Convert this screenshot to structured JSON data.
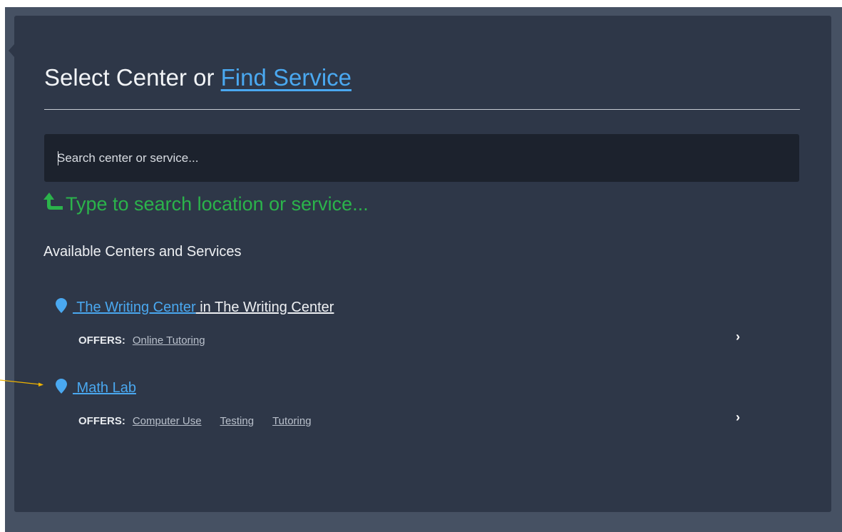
{
  "header": {
    "title_prefix": "Select Center or ",
    "title_link": "Find Service"
  },
  "search": {
    "placeholder": "Search center or service...",
    "hint": "Type to search location or service..."
  },
  "section_title": "Available Centers and Services",
  "centers": [
    {
      "name": " The Writing Center",
      "location": " in The Writing Center",
      "offers_label": "OFFERS:",
      "offers": [
        "Online Tutoring"
      ]
    },
    {
      "name": " Math Lab",
      "location": "",
      "offers_label": "OFFERS:",
      "offers": [
        "Computer Use",
        "Testing",
        "Tutoring"
      ]
    }
  ],
  "colors": {
    "panel": "#2e3748",
    "link": "#4aa8f0",
    "hint": "#2bb34b",
    "annotation_arrow": "#f0b400"
  },
  "icons": {
    "hint": "up-turn-arrow-icon",
    "center": "map-pin-icon",
    "row_action": "chevron-right-icon"
  }
}
